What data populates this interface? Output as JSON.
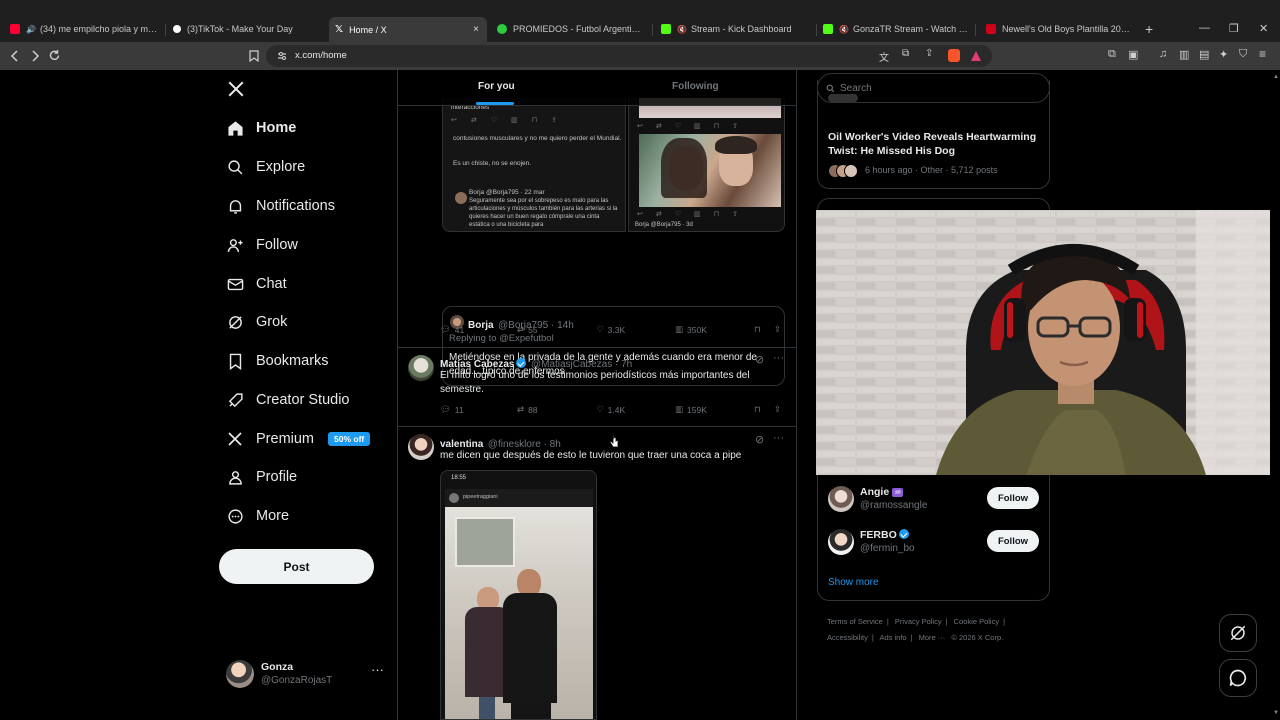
{
  "browser": {
    "tabs": [
      {
        "title": "(34) me empilcho piola y me pe...",
        "favicon_color": "#ff0033"
      },
      {
        "title": "(3)TikTok - Make Your Day",
        "favicon_color": "#ffffff"
      },
      {
        "title": "Home / X",
        "favicon_color": "#ffffff",
        "active": true
      },
      {
        "title": "PROMIEDOS - Futbol Argentino - Fu",
        "favicon_color": "#2ecc40"
      },
      {
        "title": "Stream - Kick Dashboard",
        "favicon_color": "#53fc18"
      },
      {
        "title": "GonzaTR Stream - Watch Live on",
        "favicon_color": "#53fc18"
      },
      {
        "title": "Newell's Old Boys Plantilla 2013-14",
        "favicon_color": "#d0021b"
      }
    ],
    "new_tab": "+",
    "close_tab": "×",
    "url": "x.com/home"
  },
  "nav": {
    "items": [
      {
        "label": "Home",
        "icon": "home-icon"
      },
      {
        "label": "Explore",
        "icon": "search-icon"
      },
      {
        "label": "Notifications",
        "icon": "bell-icon"
      },
      {
        "label": "Follow",
        "icon": "add-person-icon"
      },
      {
        "label": "Chat",
        "icon": "mail-icon"
      },
      {
        "label": "Grok",
        "icon": "grok-icon"
      },
      {
        "label": "Bookmarks",
        "icon": "bookmark-icon"
      },
      {
        "label": "Creator Studio",
        "icon": "rocket-icon"
      },
      {
        "label": "Premium",
        "icon": "x-icon"
      },
      {
        "label": "Profile",
        "icon": "person-icon"
      },
      {
        "label": "More",
        "icon": "more-circle-icon"
      }
    ],
    "premium_badge": "50% off",
    "post_label": "Post",
    "account": {
      "name": "Gonza",
      "handle": "@GonzaRojasT",
      "more": "···"
    }
  },
  "timeline": {
    "tabs": {
      "for_you": "For you",
      "following": "Following"
    },
    "shot_texts": {
      "interacciones": "interacciones",
      "mundial": "contusiones musculares y no me quiero perder el Mundial.",
      "chiste": "Es un chiste, no se enojen.",
      "borja_head": "Borja @Borja795 · 22 mar",
      "borja_body": "Seguramente sea por el sobrepeso es malo para las articulaciones y músculos también para las arterias si la quieres hacer un buen regalo cómprale una cinta estática o una bicicleta para",
      "borja_footer": "Borja @Borja795 · 3d"
    },
    "quote": {
      "name": "Borja",
      "handle": "@Borja795 · 14h",
      "replying": "Replying to @Expefutbol",
      "text": "Metiéndose en la privada de la gente y además cuando era menor de edad....típico de enfermos"
    },
    "quote_actions": {
      "replies": "41",
      "reposts": "55",
      "likes": "3.3K",
      "views": "350K"
    },
    "tweets": [
      {
        "name": "Matías Cabezas",
        "verified": true,
        "handle": "@MatiasjCabezas · 7h",
        "text": "El mito logró uno de los testimonios periodísticos más importantes del semestre.",
        "replies": "11",
        "reposts": "88",
        "likes": "1.4K",
        "views": "159K"
      },
      {
        "name": "valentina",
        "verified": false,
        "handle": "@finesklore · 8h",
        "text": "me dicen que después de esto le tuvieron que traer una coca a pipe",
        "image_status_time": "18:55",
        "image_caption": "pipeetraggiani"
      }
    ]
  },
  "sidebar": {
    "search_placeholder": "Search",
    "trend": {
      "title": "Oil Worker's Video Reveals Heartwarming Twist: He Missed His Dog",
      "meta": "6 hours ago · Other · 5,712 posts"
    },
    "who_to_follow": [
      {
        "name": "Angie",
        "emoji": "♒",
        "handle": "@ramossangle",
        "button": "Follow"
      },
      {
        "name": "FERBO",
        "verified": true,
        "handle": "@fermin_bo",
        "button": "Follow"
      }
    ],
    "show_more": "Show more",
    "footer": [
      "Terms of Service",
      "|",
      "Privacy Policy",
      "|",
      "Cookie Policy",
      "|",
      "Accessibility",
      "|",
      "Ads info",
      "|",
      "More ···",
      "© 2026 X Corp."
    ]
  },
  "colors": {
    "accent": "#1d9bf0",
    "background": "#000000",
    "border": "#2f3336",
    "muted": "#71767b"
  }
}
